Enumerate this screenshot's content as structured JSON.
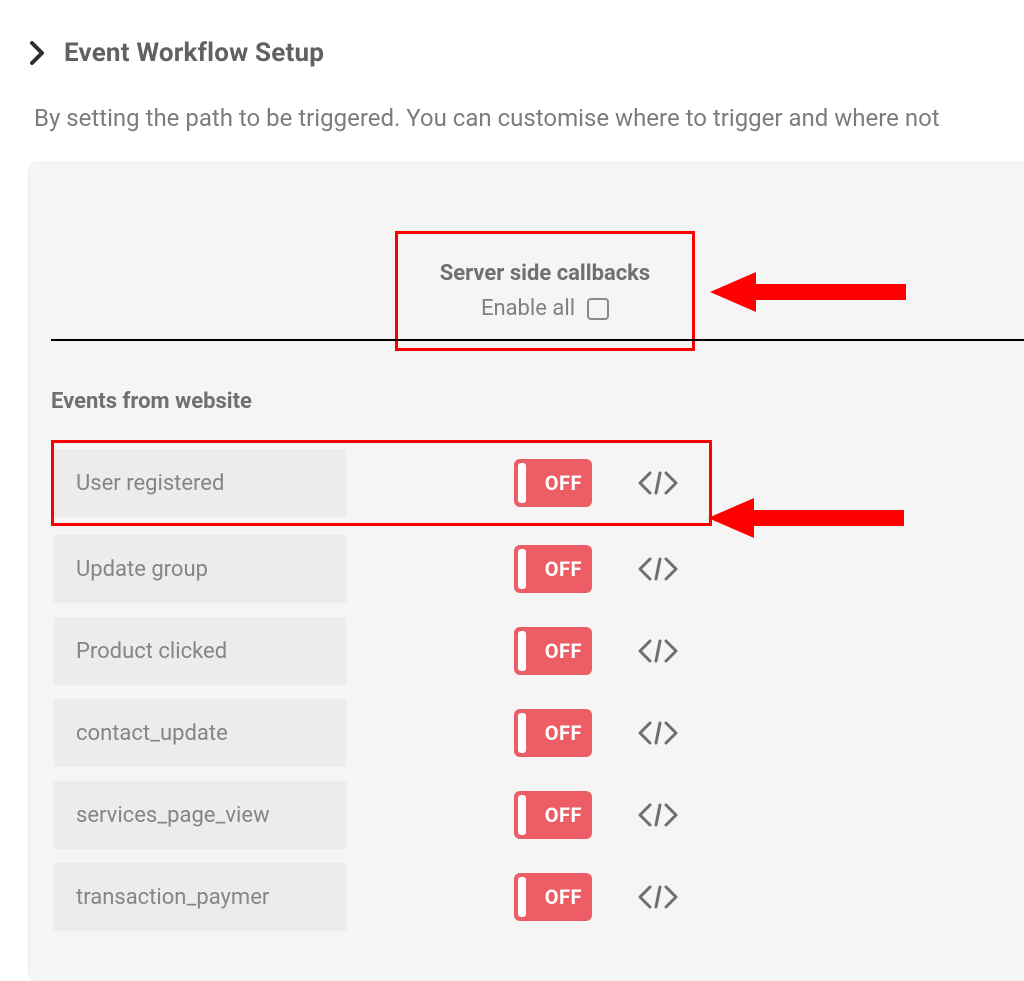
{
  "header": {
    "title": "Event Workflow Setup"
  },
  "description": "By setting the path to be triggered. You can customise where to trigger and where not",
  "callbacks": {
    "title": "Server side callbacks",
    "enable_all_label": "Enable all",
    "enable_all_checked": false
  },
  "events": {
    "section_title": "Events from website",
    "toggle_off_label": "OFF",
    "rows": [
      {
        "label": "User registered"
      },
      {
        "label": "Update group"
      },
      {
        "label": "Product clicked"
      },
      {
        "label": "contact_update"
      },
      {
        "label": "services_page_view"
      },
      {
        "label": "transaction_paymer"
      }
    ]
  },
  "annotation": {
    "color": "#ff0000"
  }
}
